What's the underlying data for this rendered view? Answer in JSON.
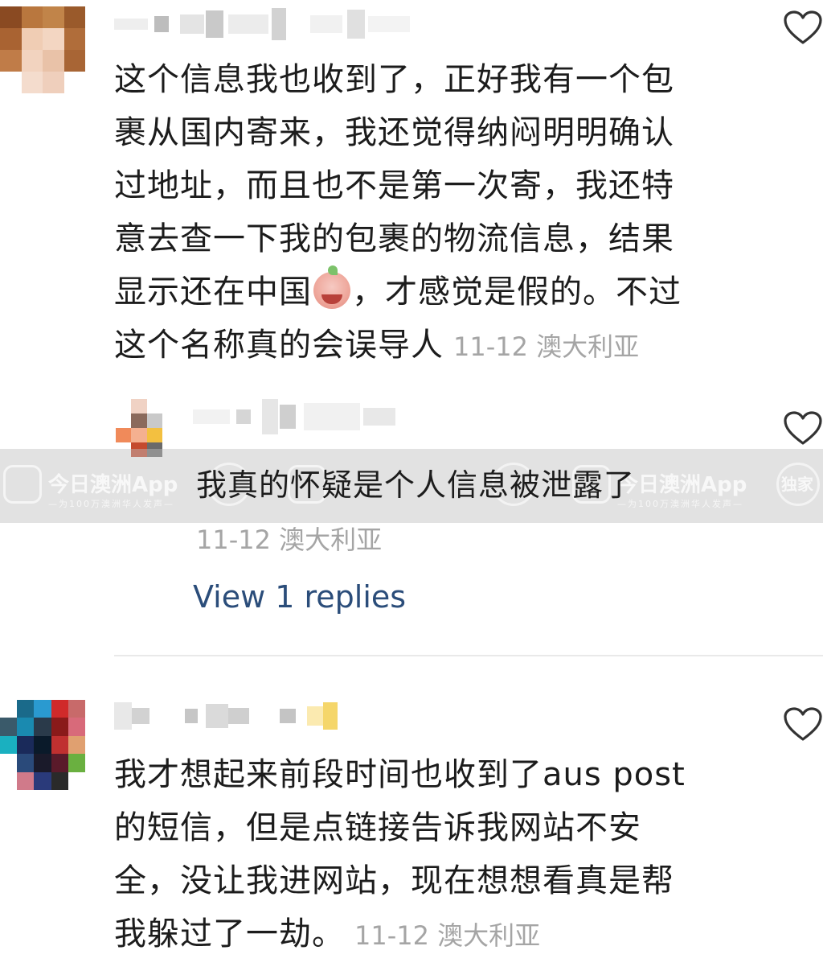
{
  "comments": [
    {
      "text": "这个信息我也收到了，正好我有一个包\n裹从国内寄来，我还觉得纳闷明明确认\n过地址，而且也不是第一次寄，我还特\n意去查一下我的包裹的物流信息，结果\n显示还在中国",
      "text_after_emoji": "，才感觉是假的。不过\n这个名称真的会误导人",
      "emoji": "crying-face-emoji",
      "date": "11-12",
      "location": "澳大利亚"
    },
    {
      "text": "我才想起来前段时间也收到了aus post\n的短信，但是点链接告诉我网站不安\n全，没让我进网站，现在想想看真是帮\n我躲过了一劫。",
      "date": "11-12",
      "location": "澳大利亚"
    }
  ],
  "reply": {
    "text": "我真的怀疑是个人信息被泄露了",
    "date": "11-12",
    "location": "澳大利亚",
    "view_replies": "View 1 replies"
  },
  "watermark": {
    "brand": "今日澳洲App",
    "tagline": "—为100万澳洲华人发声—",
    "seal": "独家"
  },
  "icons": [
    "heart-outline-icon"
  ],
  "colors": {
    "link": "#2b4d7a",
    "meta": "#a5a5a5",
    "text": "#1c1c1c"
  }
}
